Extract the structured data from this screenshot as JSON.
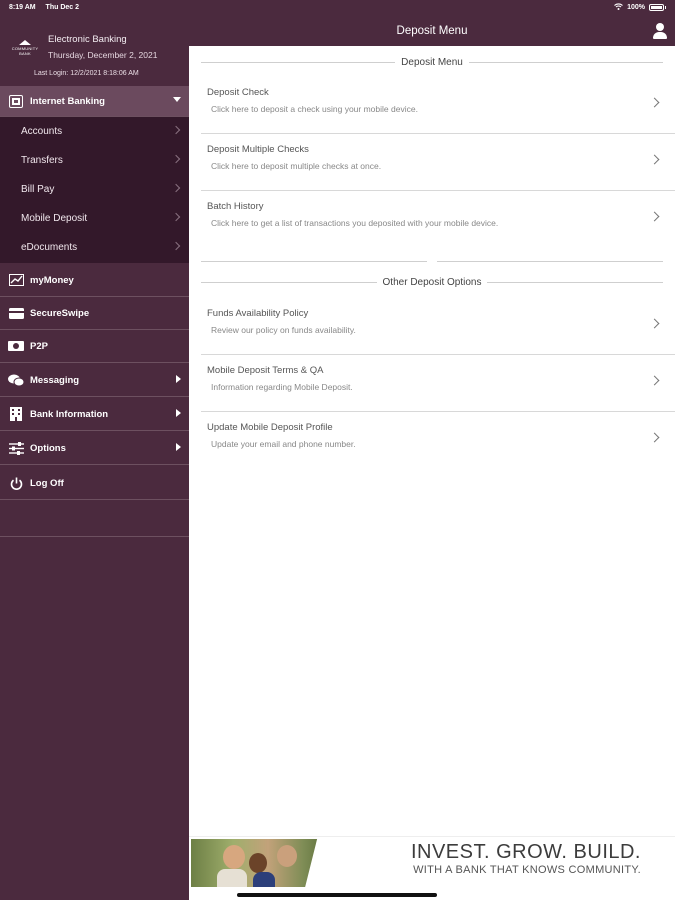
{
  "status_bar": {
    "time": "8:19 AM",
    "date": "Thu Dec 2",
    "battery": "100%"
  },
  "sidebar": {
    "logo_text": "COMMUNITY BANK",
    "app_title": "Electronic Banking",
    "date": "Thursday, December 2, 2021",
    "last_login": "Last Login: 12/2/2021 8:18:06 AM",
    "active_section": "Internet Banking",
    "sub_items": [
      "Accounts",
      "Transfers",
      "Bill Pay",
      "Mobile Deposit",
      "eDocuments"
    ],
    "sections": [
      {
        "label": "myMoney",
        "icon": "chart-icon",
        "has_arrow": false
      },
      {
        "label": "SecureSwipe",
        "icon": "card-icon",
        "has_arrow": false
      },
      {
        "label": "P2P",
        "icon": "p2p-icon",
        "has_arrow": false
      },
      {
        "label": "Messaging",
        "icon": "chat-icon",
        "has_arrow": true
      },
      {
        "label": "Bank Information",
        "icon": "building-icon",
        "has_arrow": true
      },
      {
        "label": "Options",
        "icon": "sliders-icon",
        "has_arrow": true
      },
      {
        "label": "Log Off",
        "icon": "power-icon",
        "has_arrow": false
      }
    ]
  },
  "header": {
    "title": "Deposit Menu"
  },
  "main": {
    "section1_title": "Deposit Menu",
    "section1_items": [
      {
        "title": "Deposit Check",
        "desc": "Click here to deposit a check using your mobile device."
      },
      {
        "title": "Deposit Multiple Checks",
        "desc": "Click here to deposit multiple checks at once."
      },
      {
        "title": "Batch History",
        "desc": "Click here to get a list of transactions you deposited with your mobile device."
      }
    ],
    "section2_title": "Other Deposit Options",
    "section2_items": [
      {
        "title": "Funds Availability Policy",
        "desc": "Review our policy on funds availability."
      },
      {
        "title": "Mobile Deposit Terms & QA",
        "desc": "Information regarding Mobile Deposit."
      },
      {
        "title": "Update Mobile Deposit Profile",
        "desc": "Update your email and phone number."
      }
    ]
  },
  "banner": {
    "headline": "INVEST. GROW. BUILD.",
    "subline": "WITH A BANK THAT KNOWS COMMUNITY."
  },
  "colors": {
    "brand": "#4b2a3e",
    "submenu": "#33182a",
    "active": "#6b4a5e"
  }
}
